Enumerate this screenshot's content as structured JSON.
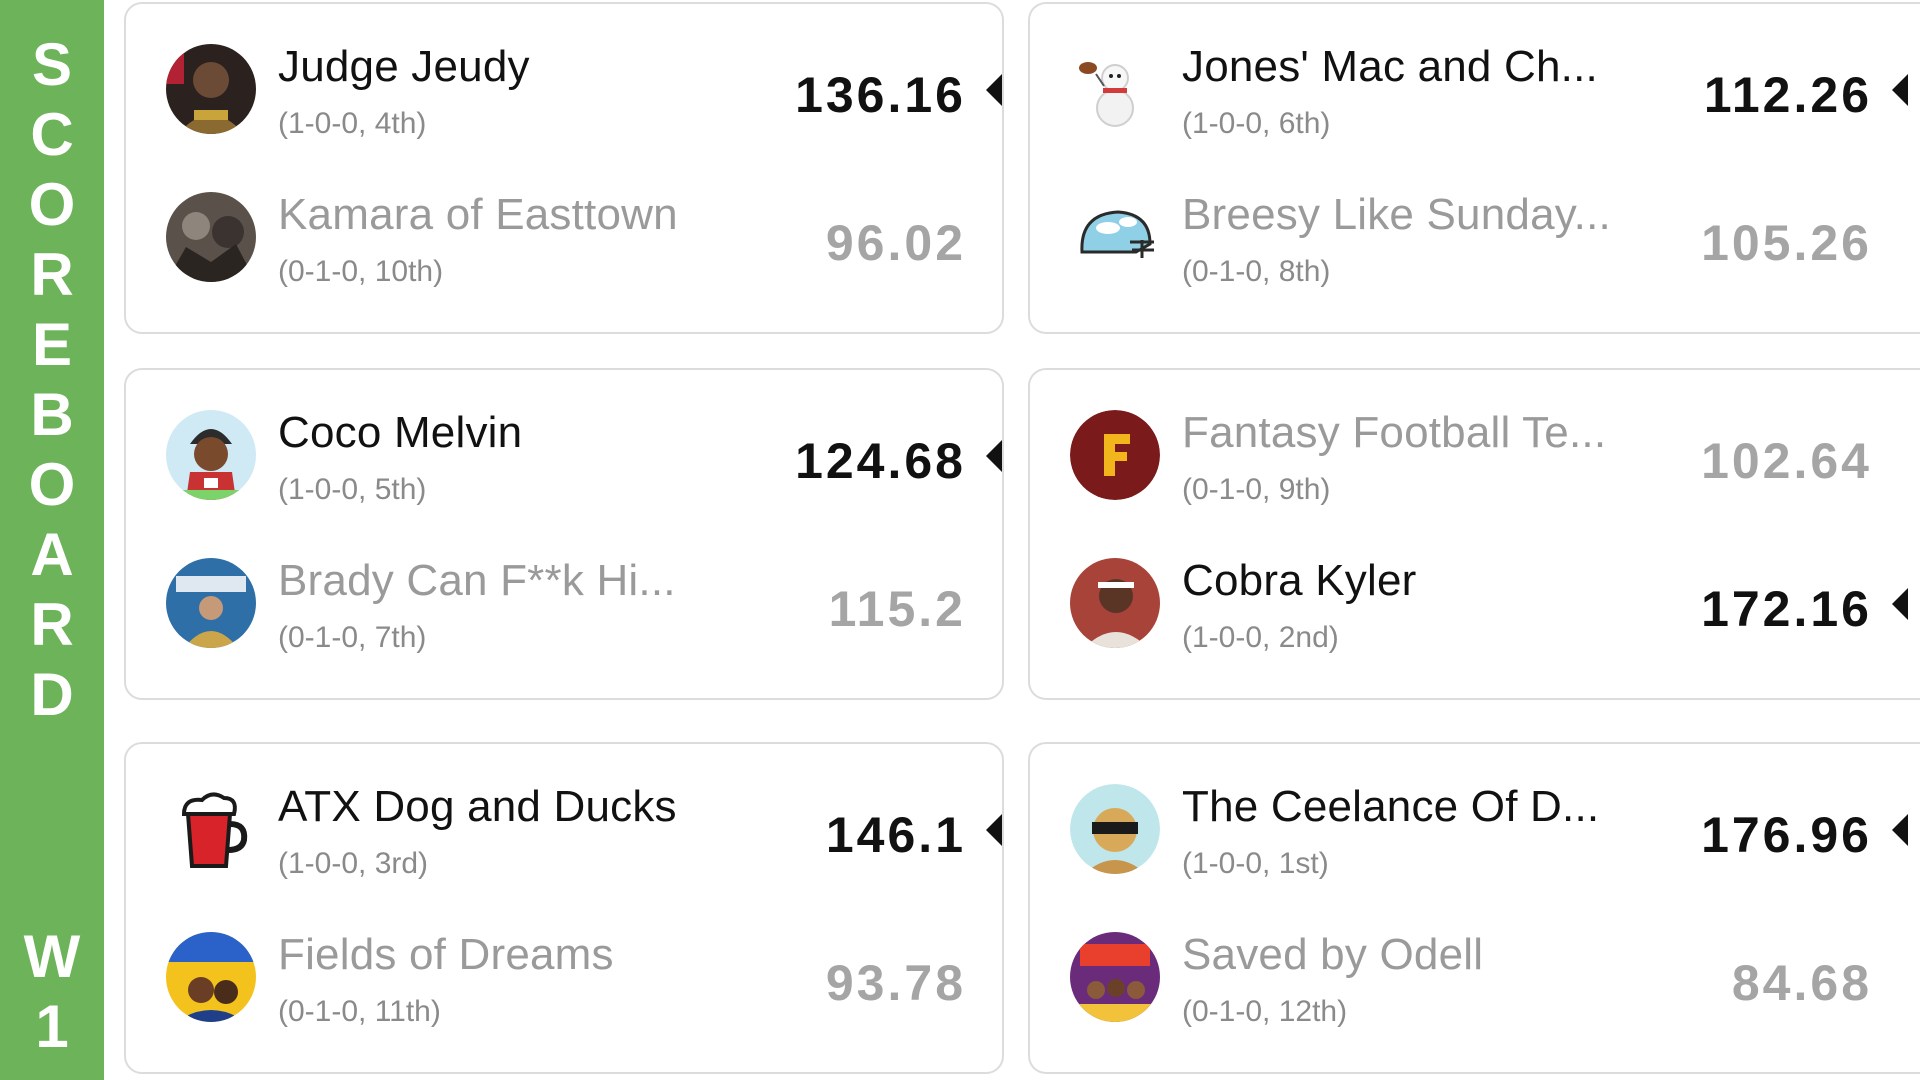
{
  "sidebar": {
    "title_letters": [
      "S",
      "C",
      "O",
      "R",
      "E",
      "B",
      "O",
      "A",
      "R",
      "D"
    ],
    "week_letters": [
      "W",
      "1"
    ],
    "color": "#6db35a"
  },
  "matchups": [
    {
      "teams": [
        {
          "name": "Judge Jeudy",
          "record": "(1-0-0, 4th)",
          "score": "136.16",
          "winner": true,
          "avatar_icon": "player-photo-avatar"
        },
        {
          "name": "Kamara of Easttown",
          "record": "(0-1-0, 10th)",
          "score": "96.02",
          "winner": false,
          "avatar_icon": "player-photo-avatar"
        }
      ]
    },
    {
      "teams": [
        {
          "name": "Jones' Mac and Ch...",
          "record": "(1-0-0, 6th)",
          "score": "112.26",
          "winner": true,
          "avatar_icon": "snowman-football-icon"
        },
        {
          "name": "Breesy Like Sunday...",
          "record": "(0-1-0, 8th)",
          "score": "105.26",
          "winner": false,
          "avatar_icon": "cloud-helmet-icon"
        }
      ]
    },
    {
      "teams": [
        {
          "name": "Coco Melvin",
          "record": "(1-0-0, 5th)",
          "score": "124.68",
          "winner": true,
          "avatar_icon": "cartoon-player-avatar"
        },
        {
          "name": "Brady Can F**k Hi...",
          "record": "(0-1-0, 7th)",
          "score": "115.2",
          "winner": false,
          "avatar_icon": "player-photo-avatar"
        }
      ]
    },
    {
      "teams": [
        {
          "name": "Fantasy Football Te...",
          "record": "(0-1-0, 9th)",
          "score": "102.64",
          "winner": false,
          "avatar_icon": "letter-f-logo-icon"
        },
        {
          "name": "Cobra Kyler",
          "record": "(1-0-0, 2nd)",
          "score": "172.16",
          "winner": true,
          "avatar_icon": "player-photo-avatar"
        }
      ]
    },
    {
      "teams": [
        {
          "name": "ATX Dog and Ducks",
          "record": "(1-0-0, 3rd)",
          "score": "146.1",
          "winner": true,
          "avatar_icon": "beer-mug-icon"
        },
        {
          "name": "Fields of Dreams",
          "record": "(0-1-0, 11th)",
          "score": "93.78",
          "winner": false,
          "avatar_icon": "cereal-box-avatar"
        }
      ]
    },
    {
      "teams": [
        {
          "name": "The Ceelance Of D...",
          "record": "(1-0-0, 1st)",
          "score": "176.96",
          "winner": true,
          "avatar_icon": "masked-face-avatar"
        },
        {
          "name": "Saved by Odell",
          "record": "(0-1-0, 12th)",
          "score": "84.68",
          "winner": false,
          "avatar_icon": "saved-by-odell-avatar"
        }
      ]
    }
  ]
}
